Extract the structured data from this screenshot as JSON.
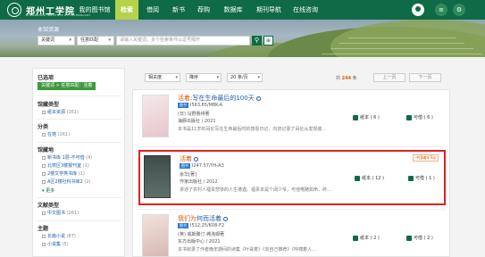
{
  "brand": {
    "name": "郑州工学院",
    "subtitle": "ZHENGZHOU INSTITUTE OF TECHNOLOGY"
  },
  "nav": {
    "items": [
      {
        "label": "我的图书馆",
        "active": false
      },
      {
        "label": "检索",
        "active": true
      },
      {
        "label": "借阅",
        "active": false
      },
      {
        "label": "新书",
        "active": false
      },
      {
        "label": "荐购",
        "active": false
      },
      {
        "label": "数据库",
        "active": false
      },
      {
        "label": "期刊导航",
        "active": false
      },
      {
        "label": "在线咨询",
        "active": false
      }
    ],
    "accent": "#b4d34a",
    "bar_color": "#0f6b45"
  },
  "search": {
    "title": "本馆资源",
    "field_select": "关键词",
    "match_select": "任意匹配",
    "placeholder": "请输入关键词，多个检索条件以逗号隔开",
    "search_icon": "search-icon",
    "advanced_icon": "advanced-search-icon"
  },
  "sidebar": {
    "filter_title": "已选项",
    "filter_tag": "关键词 > 任意匹配：活着",
    "groups": [
      {
        "title": "馆藏类型",
        "items": [
          {
            "label": "纸本资源",
            "count": "(261)"
          }
        ]
      },
      {
        "title": "分类",
        "items": [
          {
            "label": "在馆",
            "count": "(261)"
          }
        ]
      },
      {
        "title": "馆藏地",
        "items": [
          {
            "label": "新书库 1层-不可借",
            "count": "(4)"
          },
          {
            "label": "北校区3楼报刊室",
            "count": "(1)"
          },
          {
            "label": "2楼文学类书库",
            "count": "(1)"
          },
          {
            "label": "A区2楼社科书库2",
            "count": "(2)"
          }
        ],
        "more": "更多"
      },
      {
        "title": "文献类型",
        "items": [
          {
            "label": "中文图书",
            "count": "(261)"
          }
        ]
      },
      {
        "title": "主题",
        "items": [
          {
            "label": "长篇小说",
            "count": "(87)"
          },
          {
            "label": "小说集",
            "count": "(5)"
          }
        ]
      }
    ]
  },
  "toolbar": {
    "sort_relevance": "相关度",
    "order": "降序",
    "per_page": "20 条/页",
    "result_prefix": "共",
    "result_count": "244",
    "result_suffix": "条",
    "prev": "上一页",
    "next": "下一页"
  },
  "results": [
    {
      "title_hl": "活着",
      "title_rest": ":写在生命最后的100天",
      "badge": "图书",
      "call_no": "I563.65/M8K-A",
      "author": "(日) 马野惠绯著",
      "publisher": "海豚出版社 / 2021",
      "desc": "本书是11岁的哥伦写在生命最后时的感恩日记，内容记录了哥伦从发现癌…",
      "paper_label": "纸本",
      "paper_val": "( 6 )",
      "avail_label": "可借",
      "avail_val": "( 6 )",
      "cover_color": "#f0e0e4",
      "selected": false
    },
    {
      "title_hl": "活着",
      "title_rest": "",
      "badge": "图书",
      "call_no": "I247.57/YH-A3",
      "author": "余华[著]",
      "publisher": "作家出版社 / 2012",
      "desc": "讲述了农村人福贵悲惨的人生遭遇。福贵本是个阔少爷，可他嗜赌如命，终…",
      "paper_label": "纸本",
      "paper_val": "( 12 )",
      "avail_label": "可借",
      "avail_val": "( 1 )",
      "corner_tag": "中国编年Top",
      "cover_color": "#4a5a58",
      "selected": true
    },
    {
      "title_hl": "我们为",
      "title_rest": "何而活着",
      "badge": "图书",
      "call_no": "I512.25/K08-F2",
      "author": "(英) 威斯滕汀·弗洛姆著",
      "publisher": "东方出版中心 / 2021",
      "desc": "本书收录了作者晚年期间的诗集《叶哥麦》《向自己推荐》《呼啸着人…",
      "paper_label": "纸本",
      "paper_val": "( 2 )",
      "avail_label": "可借",
      "avail_val": "( 2 )",
      "cover_color": "#e9d4cf",
      "selected": false
    }
  ]
}
